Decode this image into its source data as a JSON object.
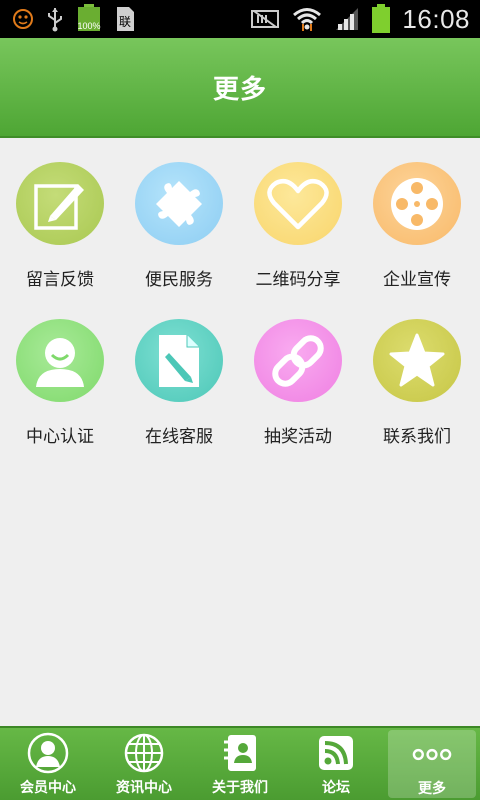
{
  "status_bar": {
    "time": "16:08",
    "battery_percent": "100%",
    "icons": [
      "face-icon",
      "usb-icon",
      "battery-small-icon",
      "sim-icon",
      "no-sim-icon",
      "wifi-icon",
      "signal-icon",
      "battery-icon"
    ]
  },
  "header": {
    "title": "更多"
  },
  "grid": {
    "items": [
      {
        "label": "留言反馈",
        "icon": "edit-icon",
        "color": "#b9d466"
      },
      {
        "label": "便民服务",
        "icon": "puzzle-icon",
        "color": "#9ed8f6"
      },
      {
        "label": "二维码分享",
        "icon": "heart-icon",
        "color": "#fbe07d"
      },
      {
        "label": "企业宣传",
        "icon": "film-reel-icon",
        "color": "#fbc57d"
      },
      {
        "label": "中心认证",
        "icon": "user-icon",
        "color": "#8fe27f"
      },
      {
        "label": "在线客服",
        "icon": "document-edit-icon",
        "color": "#62d3c5"
      },
      {
        "label": "抽奖活动",
        "icon": "link-icon",
        "color": "#f48ee9"
      },
      {
        "label": "联系我们",
        "icon": "star-icon",
        "color": "#cfcf52"
      }
    ]
  },
  "tab_bar": {
    "tabs": [
      {
        "label": "会员中心",
        "icon": "member-icon",
        "active": false
      },
      {
        "label": "资讯中心",
        "icon": "globe-icon",
        "active": false
      },
      {
        "label": "关于我们",
        "icon": "contacts-icon",
        "active": false
      },
      {
        "label": "论坛",
        "icon": "rss-icon",
        "active": false
      },
      {
        "label": "更多",
        "icon": "more-icon",
        "active": true
      }
    ]
  }
}
